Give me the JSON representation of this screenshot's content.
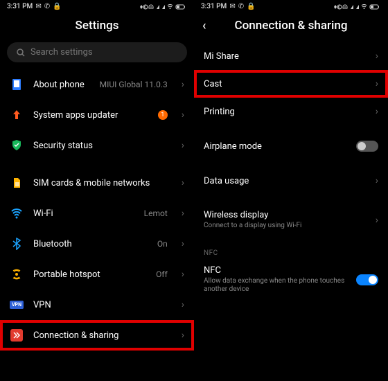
{
  "status": {
    "time": "3:31 PM",
    "icons_right": "✱ ⓪ ⏰ 📶 📶 🔋"
  },
  "left": {
    "title": "Settings",
    "search_placeholder": "Search settings",
    "items": {
      "about": {
        "label": "About phone",
        "value": "MIUI Global 11.0.3"
      },
      "updater": {
        "label": "System apps updater",
        "badge": "1"
      },
      "security": {
        "label": "Security status"
      },
      "sim": {
        "label": "SIM cards & mobile networks"
      },
      "wifi": {
        "label": "Wi-Fi",
        "value": "Lemot"
      },
      "bluetooth": {
        "label": "Bluetooth",
        "value": "On"
      },
      "hotspot": {
        "label": "Portable hotspot",
        "value": "Off"
      },
      "vpn": {
        "label": "VPN",
        "badge_text": "VPN"
      },
      "conn": {
        "label": "Connection & sharing"
      }
    }
  },
  "right": {
    "title": "Connection & sharing",
    "items": {
      "mishare": {
        "label": "Mi Share"
      },
      "cast": {
        "label": "Cast"
      },
      "printing": {
        "label": "Printing"
      },
      "airplane": {
        "label": "Airplane mode"
      },
      "data": {
        "label": "Data usage"
      },
      "wireless": {
        "label": "Wireless display",
        "sub": "Connect to a display using Wi-Fi"
      },
      "nfc_section": "NFC",
      "nfc": {
        "label": "NFC",
        "sub": "Allow data exchange when the phone touches another device"
      }
    }
  }
}
